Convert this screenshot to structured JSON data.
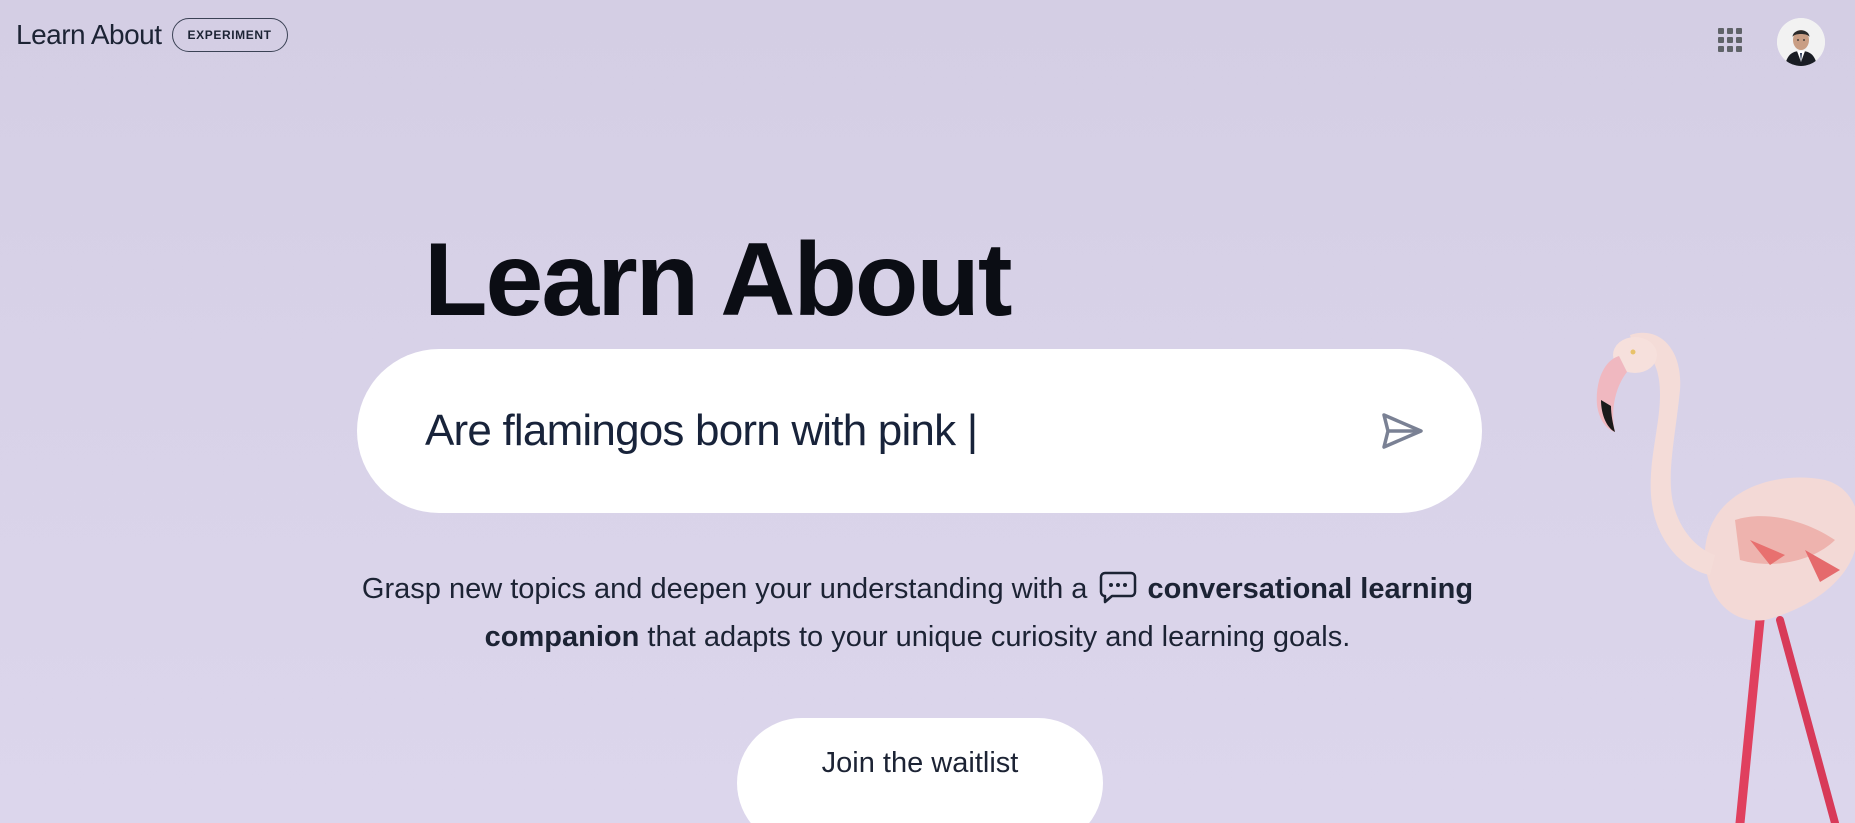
{
  "header": {
    "brand": "Learn About",
    "badge": "EXPERIMENT",
    "apps_icon": "apps-grid-icon",
    "avatar_icon": "user-avatar"
  },
  "hero": {
    "title": "Learn About"
  },
  "search": {
    "value": "Are flamingos born with pink |",
    "send_icon": "send-icon"
  },
  "description": {
    "part1": "Grasp new topics and deepen your understanding with a",
    "bold": "conversational learning companion",
    "part2": "that adapts to your unique curiosity and learning goals.",
    "chat_icon": "chat-bubble-icon"
  },
  "cta": {
    "label": "Join the waitlist"
  },
  "colors": {
    "background": "#d8d2e8",
    "text": "#1c2334",
    "title": "#0b0d14",
    "pill": "#ffffff",
    "send_icon": "#7a8194"
  }
}
